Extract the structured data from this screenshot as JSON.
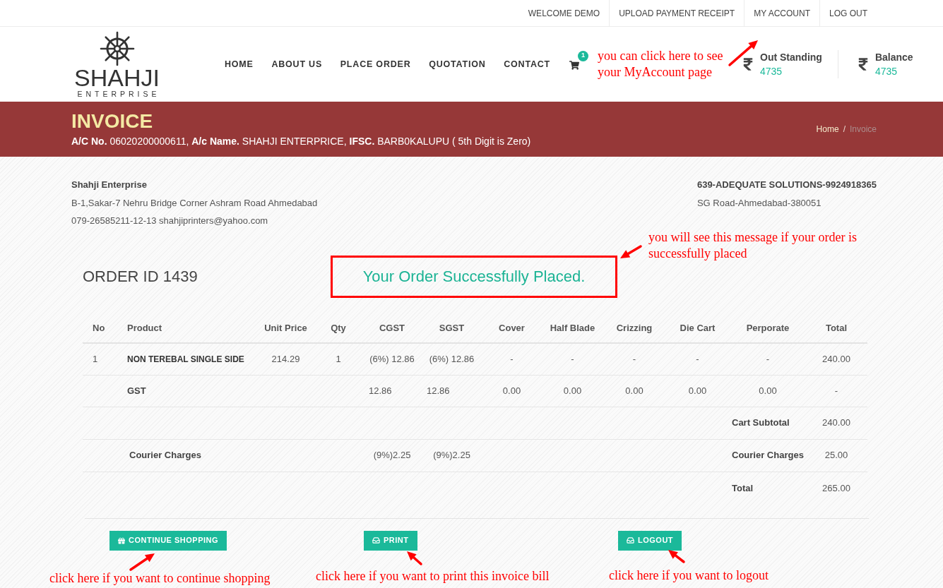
{
  "top_bar": {
    "links": [
      "WELCOME DEMO",
      "UPLOAD PAYMENT RECEIPT",
      "MY ACCOUNT",
      "LOG OUT"
    ]
  },
  "header": {
    "logo": {
      "name": "SHAHJI",
      "tagline": "ENTERPRISE"
    },
    "nav": [
      "HOME",
      "ABOUT US",
      "PLACE ORDER",
      "QUOTATION",
      "CONTACT"
    ],
    "cart": {
      "count": "1"
    },
    "annotation": "you can click here to see your MyAccount page",
    "accounts": [
      {
        "label": "Out Standing",
        "value": "4735"
      },
      {
        "label": "Balance",
        "value": "4735"
      }
    ]
  },
  "banner": {
    "title": "INVOICE",
    "account_line": "**A/C No.** 06020200000611, **A/c Name.** SHAHJI ENTERPRICE, **IFSC.** BARB0KALUPU ( 5th Digit is Zero)",
    "breadcrumb": {
      "separator": "/",
      "items": [
        {
          "label": "Home",
          "selected": false
        },
        {
          "label": "Invoice",
          "selected": true
        }
      ]
    }
  },
  "seller": {
    "name": "Shahji Enterprise",
    "lines": [
      "B-1,Sakar-7 Nehru Bridge Corner Ashram Road Ahmedabad",
      "079-26585211-12-13 shahjiprinters@yahoo.com"
    ]
  },
  "buyer": {
    "name": "639-ADEQUATE SOLUTIONS-9924918365",
    "lines": [
      "SG Road-Ahmedabad-380051"
    ]
  },
  "order": {
    "title": "ORDER ID 1439",
    "success": {
      "text": "Your Order Successfully Placed.",
      "highlighted": true,
      "annotation": "you will see this message if your order is successfully placed"
    }
  },
  "table": {
    "columns": [
      "No",
      "Product",
      "Unit Price",
      "Qty",
      "CGST",
      "SGST",
      "Cover",
      "Half Blade",
      "Crizzing",
      "Die Cart",
      "Perporate",
      "Total"
    ],
    "rows": [
      {
        "kind": "item",
        "no": "1",
        "product": "NON TEREBAL SINGLE SIDE",
        "unit_price": "214.29",
        "qty": "1",
        "cgst": "(6%) 12.86",
        "sgst": "(6%) 12.86",
        "cover": "-",
        "half_blade": "-",
        "crizzing": "-",
        "die_cart": "-",
        "perporate": "-",
        "total": "240.00"
      },
      {
        "kind": "tax",
        "product": "GST",
        "cgst": "12.86",
        "sgst": "12.86",
        "cover": "0.00",
        "half_blade": "0.00",
        "crizzing": "0.00",
        "die_cart": "0.00",
        "perporate": "0.00",
        "total": "-"
      }
    ]
  },
  "summary": [
    {
      "kind": "subtotal",
      "label": "Cart Subtotal",
      "value": "240.00"
    },
    {
      "kind": "charge",
      "name": "Courier Charges",
      "cgst": "(9%)2.25",
      "sgst": "(9%)2.25",
      "label": "Courier Charges",
      "value": "25.00"
    },
    {
      "kind": "total",
      "label": "Total",
      "value": "265.00"
    }
  ],
  "buttons": [
    {
      "kind": "shop",
      "label": "CONTINUE SHOPPING",
      "annotation": "click here if you want to continue shopping"
    },
    {
      "kind": "print",
      "label": "PRINT",
      "annotation": "click here if you want to print this invoice bill"
    },
    {
      "kind": "logout",
      "label": "LOGOUT",
      "annotation": "click here if you want to logout"
    }
  ]
}
